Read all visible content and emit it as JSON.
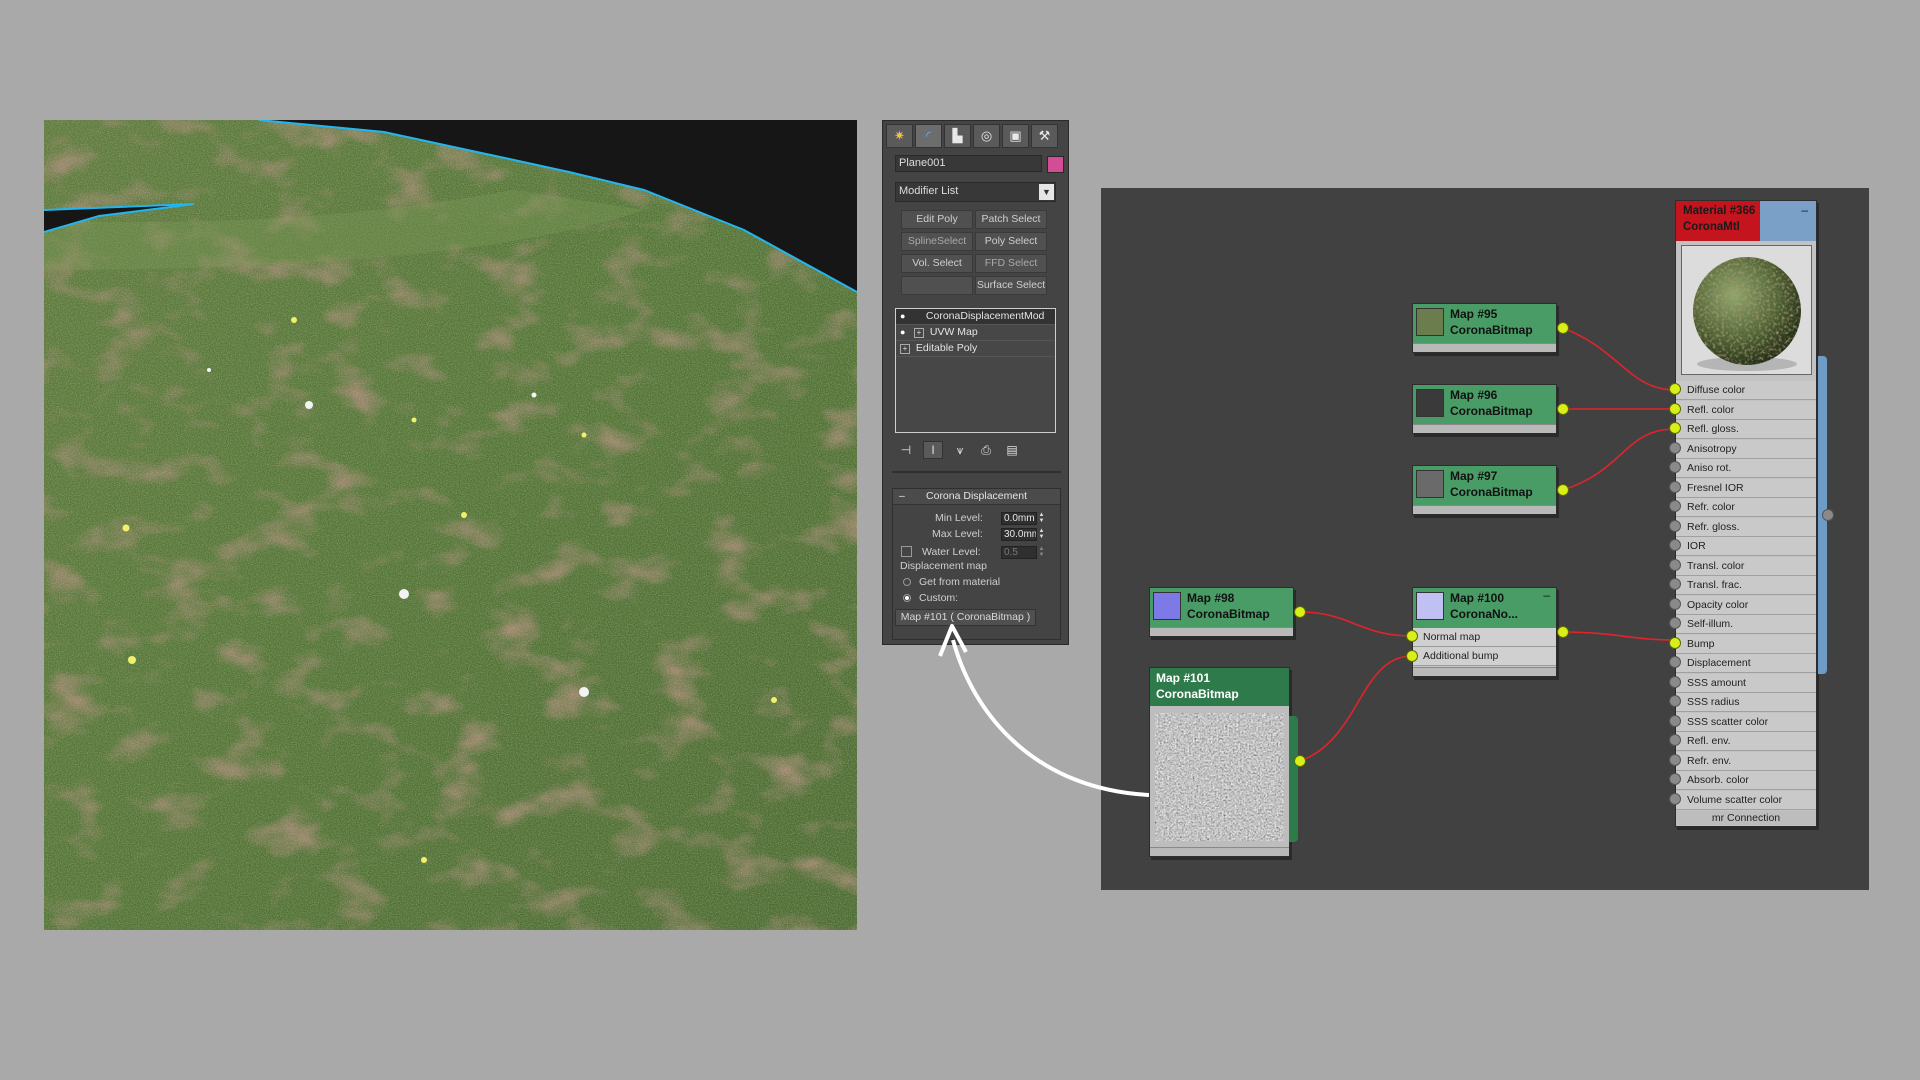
{
  "command_panel": {
    "tabs": [
      {
        "icon": "sun-icon",
        "glyph": "✷"
      },
      {
        "icon": "modify-curve-icon",
        "glyph": "◜"
      },
      {
        "icon": "hierarchy-icon",
        "glyph": "▙"
      },
      {
        "icon": "motion-icon",
        "glyph": "◎"
      },
      {
        "icon": "display-monitor-icon",
        "glyph": "▣"
      },
      {
        "icon": "utilities-hammer-icon",
        "glyph": "⚒"
      }
    ],
    "object_name": "Plane001",
    "object_color": "#d24d94",
    "modifier_list": "Modifier List",
    "modifier_buttons": [
      "Edit Poly",
      "Patch Select",
      "SplineSelect",
      "Poly Select",
      "Vol. Select",
      "FFD Select",
      "",
      "Surface Select"
    ],
    "stack": [
      {
        "label": "CoronaDisplacementMod",
        "selected": true
      },
      {
        "label": "UVW Map",
        "selected": false
      },
      {
        "label": "Editable Poly",
        "selected": false
      }
    ],
    "stack_tools": [
      {
        "icon": "pin-stack-icon",
        "glyph": "⊣"
      },
      {
        "icon": "show-end-result-icon",
        "glyph": "I"
      },
      {
        "icon": "make-unique-icon",
        "glyph": "⩛"
      },
      {
        "icon": "remove-modifier-icon",
        "glyph": "⎙"
      },
      {
        "icon": "configure-modifier-sets-icon",
        "glyph": "▤"
      }
    ],
    "rollout": {
      "title": "Corona Displacement",
      "min_level_label": "Min Level:",
      "min_level": "0.0mm",
      "max_level_label": "Max Level:",
      "max_level": "30.0mm",
      "water_level_label": "Water Level:",
      "water_level": "0.5",
      "water_level_enabled": false,
      "displacement_map_label": "Displacement map",
      "get_from_material": "Get from material",
      "custom": "Custom:",
      "custom_selected": true,
      "map_button": "Map #101 ( CoronaBitmap )"
    }
  },
  "node_editor": {
    "nodes": [
      {
        "id": "map95",
        "line1": "Map #95",
        "line2": "CoronaBitmap",
        "thumb_color": "#6b7d4d"
      },
      {
        "id": "map96",
        "line1": "Map #96",
        "line2": "CoronaBitmap",
        "thumb_color": "#3a3a3a"
      },
      {
        "id": "map97",
        "line1": "Map #97",
        "line2": "CoronaBitmap",
        "thumb_color": "#6a6a6a"
      },
      {
        "id": "map98",
        "line1": "Map #98",
        "line2": "CoronaBitmap",
        "thumb_color": "#7d7ae8"
      },
      {
        "id": "map100",
        "line1": "Map #100",
        "line2": "CoronaNo...",
        "thumb_color": "#c0c0f2",
        "inputs": [
          "Normal map",
          "Additional bump"
        ]
      },
      {
        "id": "map101",
        "line1": "Map #101",
        "line2": "CoronaBitmap"
      }
    ],
    "material": {
      "line1": "Material #366",
      "line2": "CoronaMtl",
      "minimize": "–",
      "slots": [
        "Diffuse color",
        "Refl. color",
        "Refl. gloss.",
        "Anisotropy",
        "Aniso rot.",
        "Fresnel IOR",
        "Refr. color",
        "Refr. gloss.",
        "IOR",
        "Transl. color",
        "Transl. frac.",
        "Opacity color",
        "Self-illum.",
        "Bump",
        "Displacement",
        "SSS amount",
        "SSS radius",
        "SSS scatter color",
        "Refl. env.",
        "Refr. env.",
        "Absorb. color",
        "Volume scatter color"
      ],
      "connected_slots": [
        0,
        1,
        2,
        13
      ],
      "connection_label": "mr Connection"
    },
    "wire_color": "#e0242b",
    "socket_color": "#d8ef1a"
  },
  "annotation_arrow_color": "#ffffff"
}
